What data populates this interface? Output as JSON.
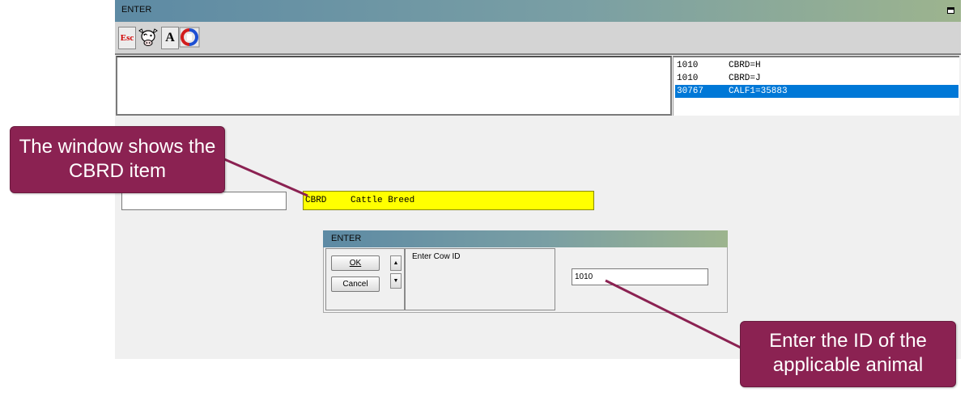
{
  "window": {
    "title": "ENTER"
  },
  "toolbar": {
    "esc_label": "Esc",
    "font_label": "A",
    "icons": [
      "esc-icon",
      "cow-icon",
      "font-icon",
      "refresh-icon"
    ]
  },
  "log_list": {
    "rows": [
      {
        "id": "1010",
        "value": "CBRD=H"
      },
      {
        "id": "1010",
        "value": "CBRD=J"
      },
      {
        "id": "30767",
        "value": "CALF1=35883"
      }
    ],
    "selected_index": 2
  },
  "item_bar": {
    "code": "CBRD",
    "description": "Cattle Breed"
  },
  "dialog": {
    "title": "ENTER",
    "ok_label": "OK",
    "cancel_label": "Cancel",
    "prompt": "Enter Cow ID",
    "cow_id_value": "1010"
  },
  "callouts": {
    "first": "The window shows the CBRD item",
    "second": "Enter the ID of the applicable animal"
  },
  "colors": {
    "callout": "#8b2252",
    "item_highlight": "#ffff00",
    "selection": "#0078d7"
  }
}
